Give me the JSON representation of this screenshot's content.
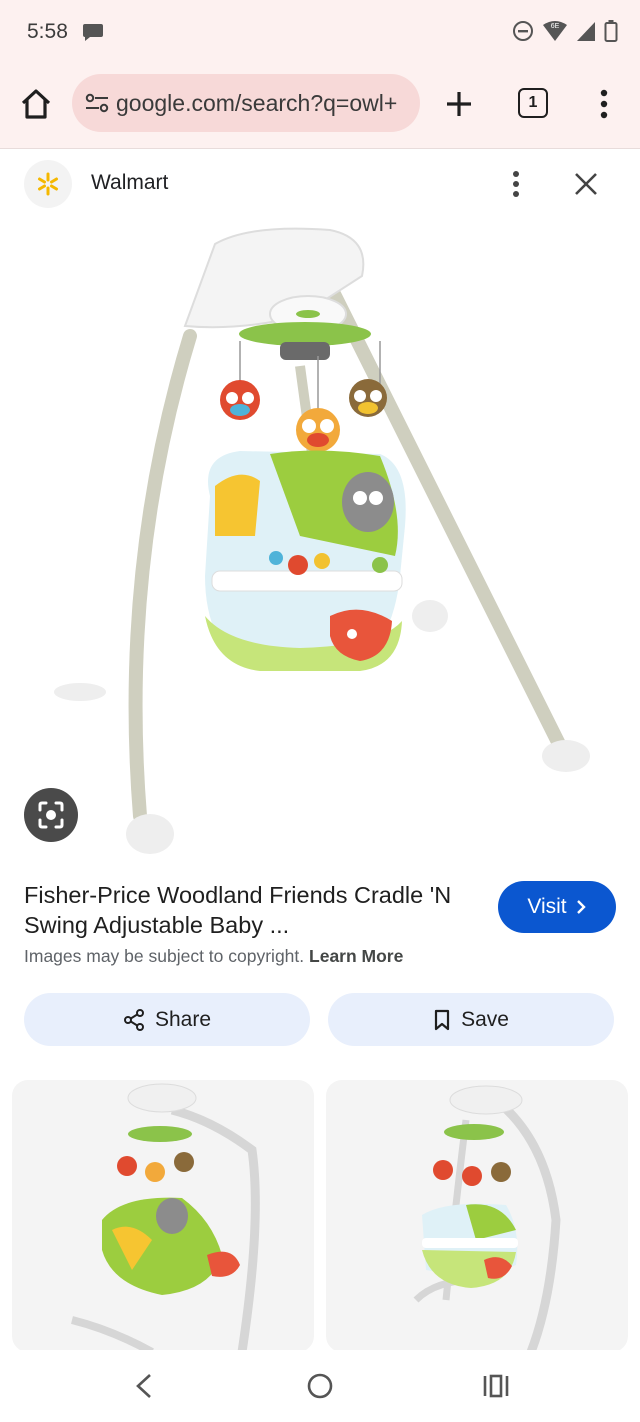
{
  "status": {
    "time": "5:58",
    "network": "6E"
  },
  "browser": {
    "url": "google.com/search?q=owl+",
    "tab_count": "1"
  },
  "source": {
    "name": "Walmart"
  },
  "result": {
    "title": "Fisher-Price Woodland Friends Cradle 'N Swing Adjustable Baby ...",
    "visit_label": "Visit",
    "copyright_text": "Images may be subject to copyright.",
    "learn_more": "Learn More",
    "share_label": "Share",
    "save_label": "Save"
  },
  "icons": {
    "status": [
      "message-icon",
      "dnd-icon",
      "wifi-icon",
      "signal-icon",
      "battery-icon"
    ],
    "toolbar": [
      "home-icon",
      "site-settings-icon",
      "plus-icon",
      "tabs-icon",
      "more-vert-icon"
    ],
    "navigation": [
      "back-icon",
      "home-circle-icon",
      "recents-icon"
    ]
  },
  "colors": {
    "accent": "#0b57d0",
    "chrome_bg": "#fdf1f0",
    "urlbar_bg": "#f7d9d8",
    "chip_bg": "#e8effc"
  }
}
